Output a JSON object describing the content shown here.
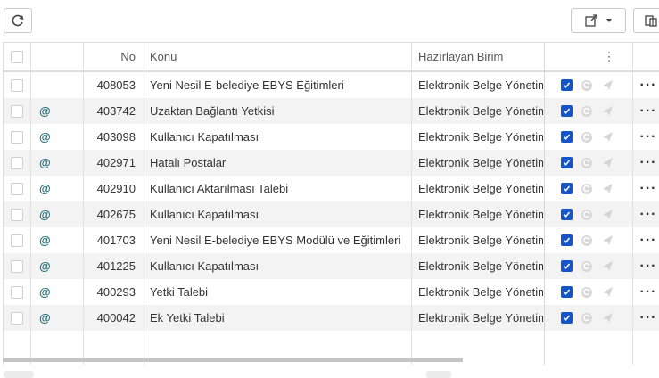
{
  "toolbar": {
    "refresh_icon": "refresh-icon",
    "export_icon": "export-icon",
    "dropdown_icon": "caret-down-icon",
    "columns_icon": "columns-icon"
  },
  "table": {
    "headers": {
      "no": "No",
      "subject": "Konu",
      "unit": "Hazırlayan Birim",
      "menu": "⋮"
    },
    "rows": [
      {
        "no": "408053",
        "at": "",
        "subject": "Yeni Nesil E-belediye EBYS Eğitimleri",
        "unit": "Elektronik Belge Yönetim Sistemi",
        "more": "···"
      },
      {
        "no": "403742",
        "at": "@",
        "subject": "Uzaktan Bağlantı Yetkisi",
        "unit": "Elektronik Belge Yönetim Sistemi",
        "more": "···"
      },
      {
        "no": "403098",
        "at": "@",
        "subject": "Kullanıcı Kapatılması",
        "unit": "Elektronik Belge Yönetim Sistemi",
        "more": "···"
      },
      {
        "no": "402971",
        "at": "@",
        "subject": "Hatalı Postalar",
        "unit": "Elektronik Belge Yönetim Sistemi",
        "more": "···"
      },
      {
        "no": "402910",
        "at": "@",
        "subject": "Kullanıcı Aktarılması Talebi",
        "unit": "Elektronik Belge Yönetim Sistemi",
        "more": "···"
      },
      {
        "no": "402675",
        "at": "@",
        "subject": "Kullanıcı Kapatılması",
        "unit": "Elektronik Belge Yönetim Sistemi",
        "more": "···"
      },
      {
        "no": "401703",
        "at": "@",
        "subject": "Yeni Nesil E-belediye EBYS Modülü ve Eğitimleri",
        "unit": "Elektronik Belge Yönetim Sistemi",
        "more": "···"
      },
      {
        "no": "401225",
        "at": "@",
        "subject": "Kullanıcı Kapatılması",
        "unit": "Elektronik Belge Yönetim Sistemi",
        "more": "···"
      },
      {
        "no": "400293",
        "at": "@",
        "subject": "Yetki Talebi",
        "unit": "Elektronik Belge Yönetim Sistemi",
        "more": "···"
      },
      {
        "no": "400042",
        "at": "@",
        "subject": "Ek Yetki Talebi",
        "unit": "Elektronik Belge Yönetim Sistemi",
        "more": "···"
      }
    ]
  },
  "colors": {
    "accent": "#1456c8",
    "at_sign": "#1d6a73",
    "row_alt": "#f3f3f3"
  }
}
